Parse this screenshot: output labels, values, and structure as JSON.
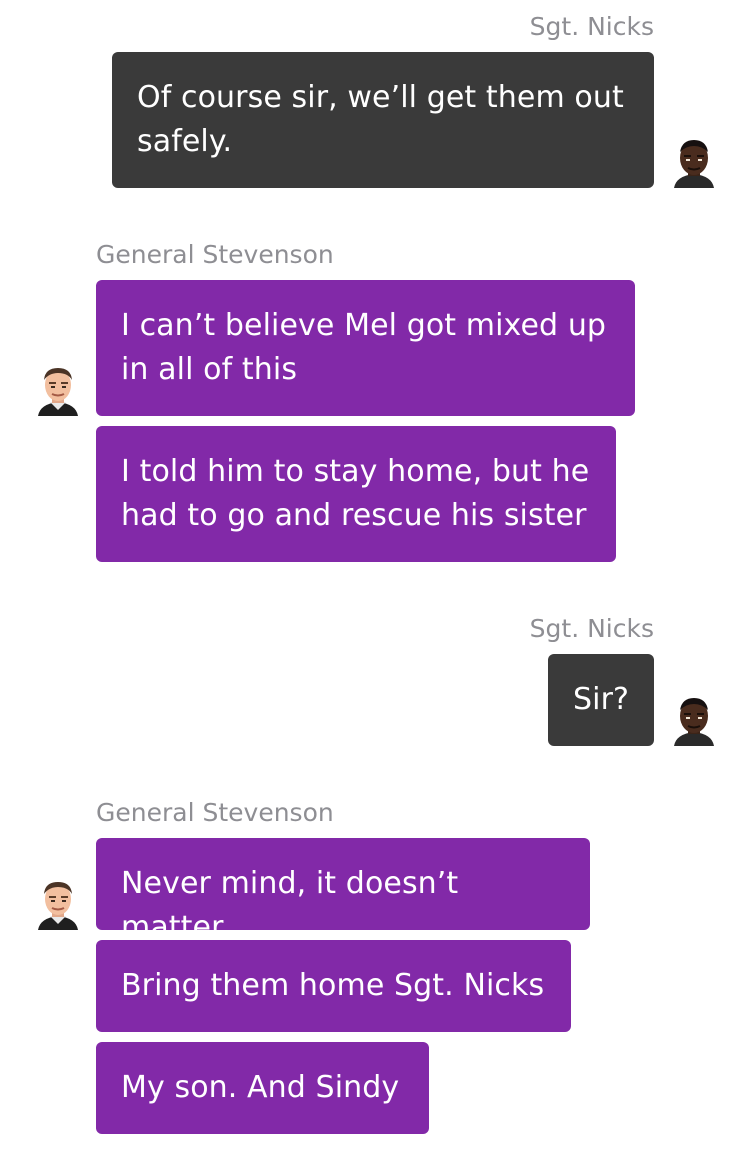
{
  "colors": {
    "outgoing_bubble": "#3a3a3a",
    "incoming_bubble": "#8229a8",
    "sender_name": "#8e8e93",
    "message_text": "#ffffff"
  },
  "messages": [
    {
      "sender": "Sgt. Nicks",
      "side": "right",
      "avatar_icon": "sgt-nicks-avatar-icon",
      "bubbles": [
        "Of course sir, we’ll get them out safely."
      ]
    },
    {
      "sender": "General Stevenson",
      "side": "left",
      "avatar_icon": "general-stevenson-avatar-icon",
      "bubbles": [
        "I can’t believe Mel got mixed up in all of this",
        "I told him to stay home, but he had to go and rescue his sister"
      ]
    },
    {
      "sender": "Sgt. Nicks",
      "side": "right",
      "avatar_icon": "sgt-nicks-avatar-icon",
      "bubbles": [
        "Sir?"
      ]
    },
    {
      "sender": "General Stevenson",
      "side": "left",
      "avatar_icon": "general-stevenson-avatar-icon",
      "bubbles": [
        "Never mind, it doesn’t matter",
        "Bring them home Sgt. Nicks",
        "My son. And Sindy"
      ]
    }
  ]
}
